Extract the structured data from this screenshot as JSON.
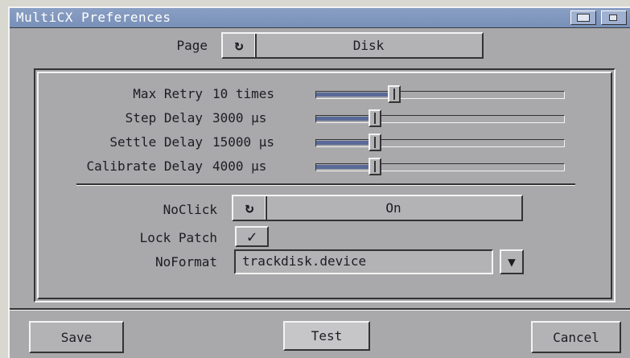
{
  "window": {
    "title": "MultiCX Preferences"
  },
  "page_selector": {
    "label": "Page",
    "value": "Disk",
    "icon": "cycle-icon"
  },
  "sliders": [
    {
      "label": "Max Retry",
      "value_text": "10 times",
      "level": 0.29
    },
    {
      "label": "Step Delay",
      "value_text": "3000 µs",
      "level": 0.21
    },
    {
      "label": "Settle Delay",
      "value_text": "15000 µs",
      "level": 0.21
    },
    {
      "label": "Calibrate Delay",
      "value_text": "4000 µs",
      "level": 0.21
    }
  ],
  "noclick": {
    "label": "NoClick",
    "value": "On",
    "icon": "cycle-icon"
  },
  "lock_patch": {
    "label": "Lock Patch",
    "checked": true,
    "glyph": "✓"
  },
  "noformat": {
    "label": "NoFormat",
    "value": "trackdisk.device",
    "icon": "dropdown-arrow-icon"
  },
  "buttons": {
    "save": "Save",
    "test": "Test",
    "cancel": "Cancel"
  },
  "colors": {
    "window_bg": "#a9a9ab",
    "titlebar": "#7f96bd",
    "slider_fill": "#5a6a98"
  }
}
